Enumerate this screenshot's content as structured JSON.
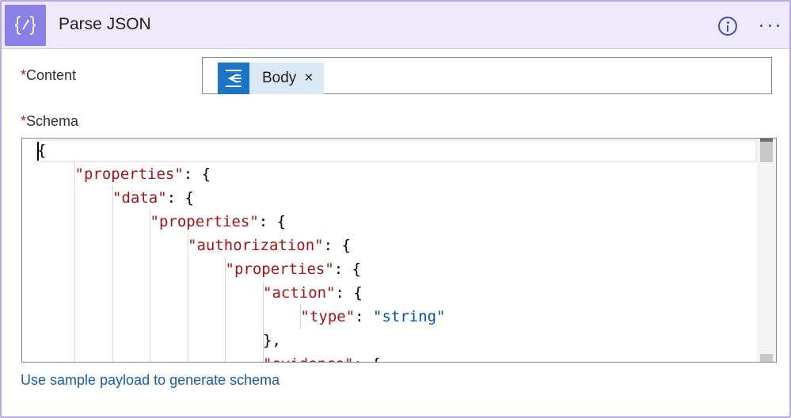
{
  "action": {
    "title": "Parse JSON",
    "icon": "curly-braces-icon",
    "icon_glyph": "{⁄}",
    "accent_color": "#8b7fe8"
  },
  "header": {
    "info_icon": "info-icon",
    "more_icon": "more-options-icon"
  },
  "fields": {
    "required_marker": "*",
    "content_label": "Content",
    "schema_label": "Schema",
    "content_token": {
      "label": "Body",
      "remove_glyph": "×",
      "icon": "http-request-icon",
      "token_color": "#1b74c5"
    }
  },
  "schema_code": {
    "lines": [
      {
        "indent": 0,
        "key": "",
        "sep": "",
        "value": "",
        "tail": "{"
      },
      {
        "indent": 1,
        "key": "\"properties\"",
        "sep": ": ",
        "value": "",
        "tail": "{"
      },
      {
        "indent": 2,
        "key": "\"data\"",
        "sep": ": ",
        "value": "",
        "tail": "{"
      },
      {
        "indent": 3,
        "key": "\"properties\"",
        "sep": ": ",
        "value": "",
        "tail": "{"
      },
      {
        "indent": 4,
        "key": "\"authorization\"",
        "sep": ": ",
        "value": "",
        "tail": "{"
      },
      {
        "indent": 5,
        "key": "\"properties\"",
        "sep": ": ",
        "value": "",
        "tail": "{"
      },
      {
        "indent": 6,
        "key": "\"action\"",
        "sep": ": ",
        "value": "",
        "tail": "{"
      },
      {
        "indent": 7,
        "key": "\"type\"",
        "sep": ": ",
        "value": "\"string\"",
        "tail": ""
      },
      {
        "indent": 6,
        "key": "",
        "sep": "",
        "value": "",
        "tail": "},"
      },
      {
        "indent": 6,
        "key": "\"evidence\"",
        "sep": ": ",
        "value": "",
        "tail": "{"
      }
    ]
  },
  "links": {
    "generate_schema": "Use sample payload to generate schema"
  }
}
